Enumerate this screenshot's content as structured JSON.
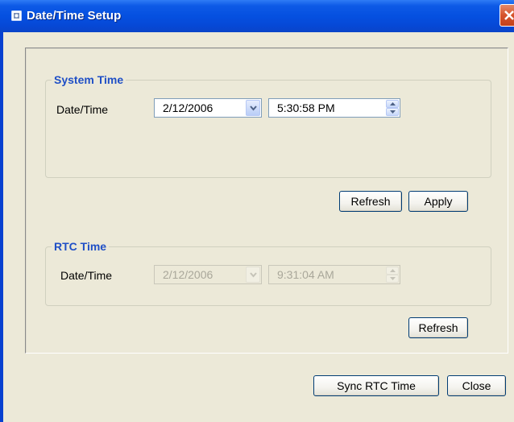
{
  "window": {
    "title": "Date/Time Setup",
    "icon": "window-icon",
    "accent_color": "#0550e0"
  },
  "system_time": {
    "group_title": "System Time",
    "label": "Date/Time",
    "date_value": "2/12/2006",
    "time_value": "5:30:58 PM",
    "refresh_label": "Refresh",
    "apply_label": "Apply"
  },
  "rtc_time": {
    "group_title": "RTC Time",
    "label": "Date/Time",
    "date_value": "2/12/2006",
    "time_value": "9:31:04 AM",
    "refresh_label": "Refresh"
  },
  "footer": {
    "sync_label": "Sync RTC Time",
    "close_label": "Close"
  }
}
